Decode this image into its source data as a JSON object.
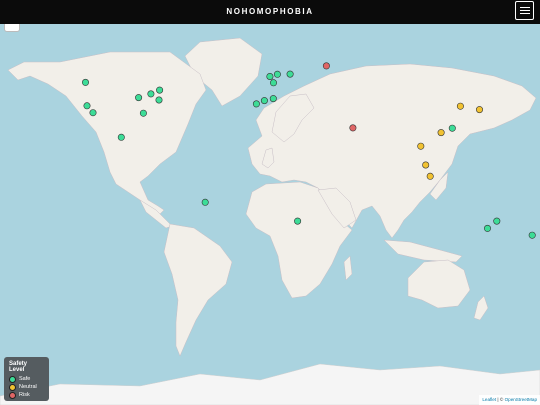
{
  "header": {
    "brand": "NOHOMOPHOBIA",
    "menu_icon": "hamburger-icon"
  },
  "legend": {
    "title": "Safety Level",
    "items": [
      {
        "label": "Safe",
        "color": "#3ddc97"
      },
      {
        "label": "Neutral",
        "color": "#f1c232"
      },
      {
        "label": "Risk",
        "color": "#e06666"
      }
    ]
  },
  "attribution": {
    "leaflet": "Leaflet",
    "separator": " | © ",
    "osm": "OpenStreetMap"
  },
  "map": {
    "water_color": "#aad3df",
    "land_color": "#f2efe9",
    "ice_color": "#f5f5f5",
    "markers": [
      {
        "level": "safe",
        "lon": -123,
        "lat": 49
      },
      {
        "level": "safe",
        "lon": -122,
        "lat": 37.7
      },
      {
        "level": "safe",
        "lon": -118,
        "lat": 34
      },
      {
        "level": "safe",
        "lon": -87.6,
        "lat": 41.9
      },
      {
        "level": "safe",
        "lon": -79.4,
        "lat": 43.7
      },
      {
        "level": "safe",
        "lon": -73.6,
        "lat": 45.5
      },
      {
        "level": "safe",
        "lon": -74,
        "lat": 40.7
      },
      {
        "level": "safe",
        "lon": -84.4,
        "lat": 33.7
      },
      {
        "level": "safe",
        "lon": -99.1,
        "lat": 19.4
      },
      {
        "level": "safe",
        "lon": -43.2,
        "lat": -22.9
      },
      {
        "level": "safe",
        "lon": -9.1,
        "lat": 38.7
      },
      {
        "level": "safe",
        "lon": -3.7,
        "lat": 40.4
      },
      {
        "level": "safe",
        "lon": 2.2,
        "lat": 41.4
      },
      {
        "level": "safe",
        "lon": -0.1,
        "lat": 51.5
      },
      {
        "level": "safe",
        "lon": 4.9,
        "lat": 52.4
      },
      {
        "level": "safe",
        "lon": 2.35,
        "lat": 48.8
      },
      {
        "level": "safe",
        "lon": 13.4,
        "lat": 52.5
      },
      {
        "level": "safe",
        "lon": 18.4,
        "lat": -33.9
      },
      {
        "level": "risk",
        "lon": 37.6,
        "lat": 55.7
      },
      {
        "level": "risk",
        "lon": 55.3,
        "lat": 25.2
      },
      {
        "level": "neutral",
        "lon": 139.7,
        "lat": 35.7
      },
      {
        "level": "neutral",
        "lon": 126.9,
        "lat": 37.5
      },
      {
        "level": "safe",
        "lon": 121.5,
        "lat": 25
      },
      {
        "level": "neutral",
        "lon": 114.1,
        "lat": 22.3
      },
      {
        "level": "neutral",
        "lon": 100.5,
        "lat": 13.7
      },
      {
        "level": "neutral",
        "lon": 103.8,
        "lat": 1.35
      },
      {
        "level": "neutral",
        "lon": 106.8,
        "lat": -6.2
      },
      {
        "level": "safe",
        "lon": 151.2,
        "lat": -33.9
      },
      {
        "level": "safe",
        "lon": 145,
        "lat": -37.8
      },
      {
        "level": "safe",
        "lon": 174.8,
        "lat": -41.3
      }
    ]
  }
}
